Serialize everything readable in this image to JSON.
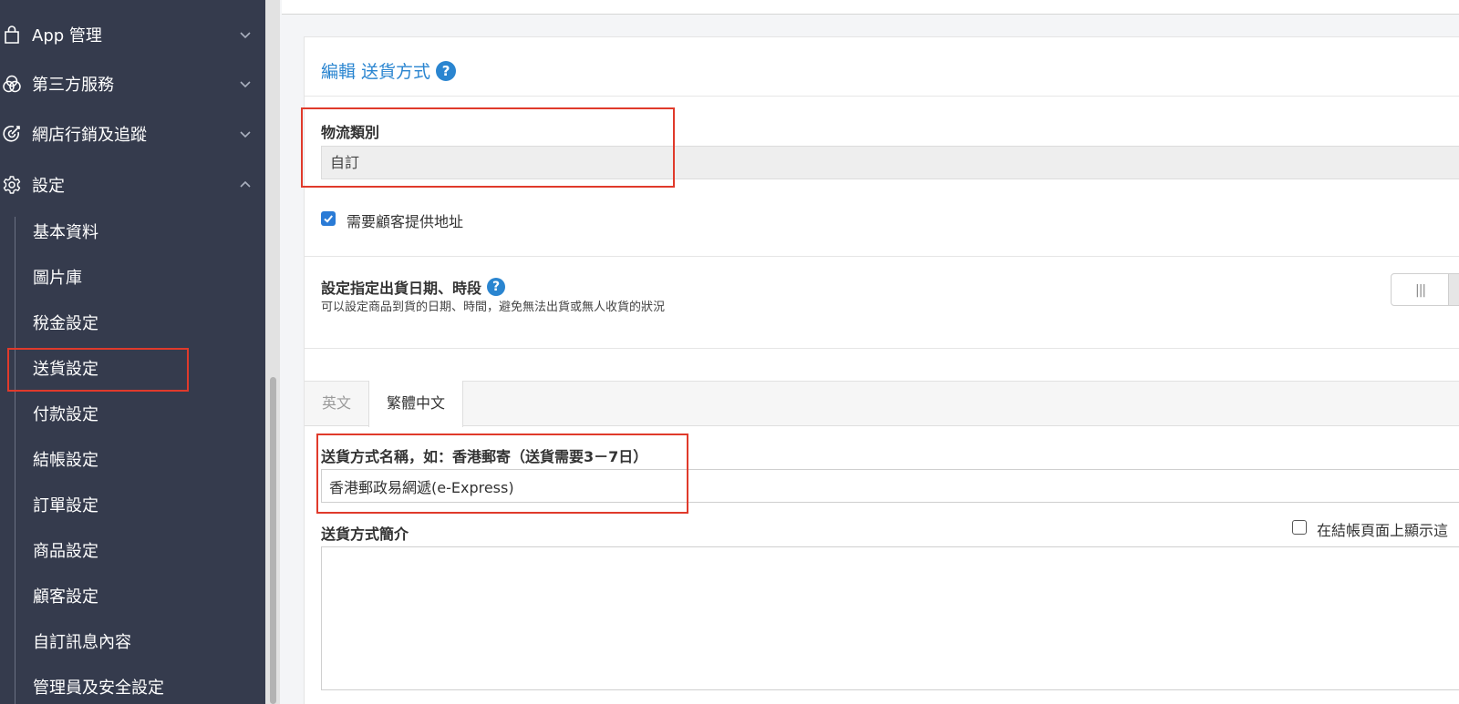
{
  "sidebar": {
    "groups": [
      {
        "label": "App 管理",
        "icon": "bag-icon"
      },
      {
        "label": "第三方服務",
        "icon": "circles-icon"
      },
      {
        "label": "網店行銷及追蹤",
        "icon": "target-icon"
      },
      {
        "label": "設定",
        "icon": "gear-icon"
      }
    ],
    "settings_items": [
      "基本資料",
      "圖片庫",
      "稅金設定",
      "送貨設定",
      "付款設定",
      "結帳設定",
      "訂單設定",
      "商品設定",
      "顧客設定",
      "自訂訊息內容",
      "管理員及安全設定"
    ],
    "active_item": "送貨設定"
  },
  "card": {
    "title": "編輯 送貨方式",
    "help_icon": "?"
  },
  "logistics": {
    "label": "物流類別",
    "value": "自訂"
  },
  "address_checkbox": {
    "label": "需要顧客提供地址",
    "checked": true
  },
  "delivery_date": {
    "label": "設定指定出貨日期、時段",
    "help_icon": "?",
    "description": "可以設定商品到貨的日期、時間，避免無法出貨或無人收貨的狀況",
    "toggle_on": false
  },
  "tabs": [
    "英文",
    "繁體中文"
  ],
  "active_tab": "繁體中文",
  "method_name": {
    "label": "送貨方式名稱，如：香港郵寄（送貨需要3－7日）",
    "value": "香港郵政易網遞(e-Express)"
  },
  "method_desc": {
    "label": "送貨方式簡介",
    "show_on_checkout_label": "在結帳頁面上顯示這",
    "show_on_checkout_checked": false
  },
  "colors": {
    "sidebar_bg": "#353b4d",
    "accent": "#2a85d0",
    "highlight": "#e03a2b"
  }
}
